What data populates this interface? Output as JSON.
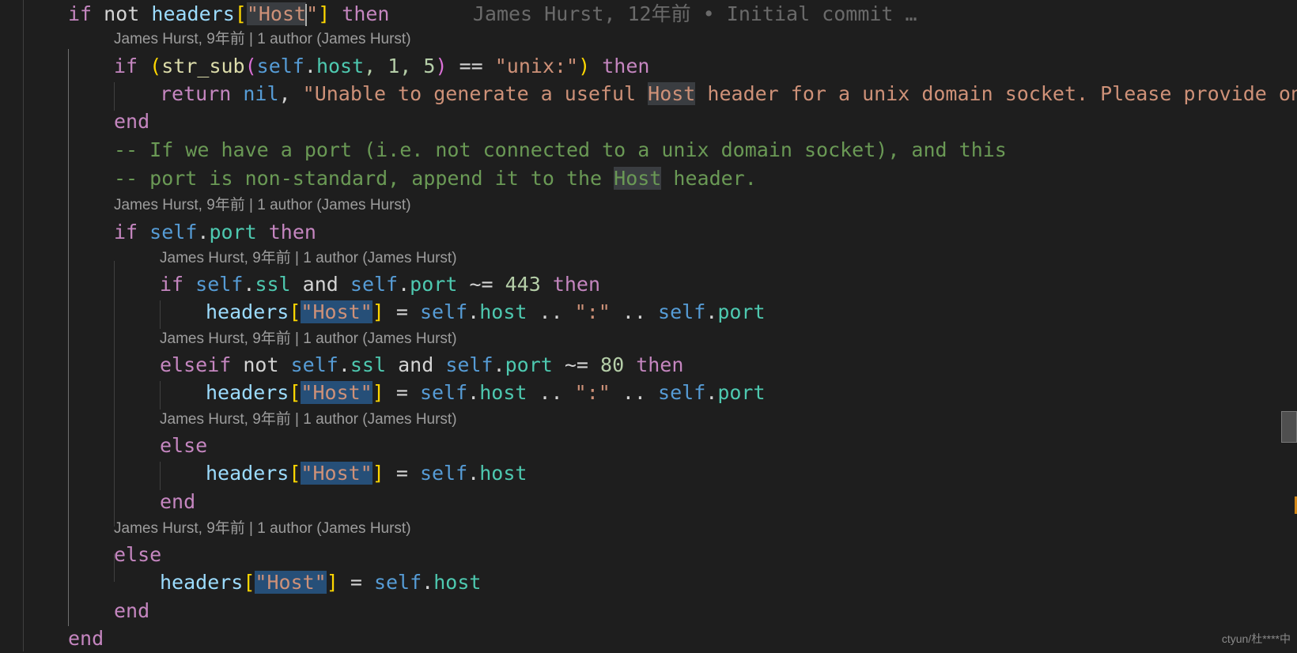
{
  "editor": {
    "lines": [
      {
        "parts": [
          "if",
          "not",
          "headers",
          "[",
          "\"Host",
          "\"",
          "]",
          "then"
        ],
        "blame": "James Hurst, 12年前 • Initial commit …"
      },
      {
        "lens": "James Hurst, 9年前 | 1 author (James Hurst)"
      },
      {
        "parts": [
          "if",
          "(",
          "str_sub",
          "(",
          "self",
          ".",
          "host",
          ", 1, 5",
          ")",
          " == ",
          "\"unix:\"",
          ")",
          "then"
        ]
      },
      {
        "parts": [
          "return",
          "nil",
          ", ",
          "\"Unable to generate a useful ",
          "Host",
          " header for a unix domain socket. Please provide one.\""
        ]
      },
      {
        "parts": [
          "end"
        ]
      },
      {
        "parts": [
          "-- If we have a port (i.e. not connected to a unix domain socket), and this"
        ]
      },
      {
        "parts": [
          "-- port is non-standard, append it to the ",
          "Host",
          " header."
        ]
      },
      {
        "lens": "James Hurst, 9年前 | 1 author (James Hurst)"
      },
      {
        "parts": [
          "if",
          "self",
          ".",
          "port",
          "then"
        ]
      },
      {
        "lens": "James Hurst, 9年前 | 1 author (James Hurst)"
      },
      {
        "parts": [
          "if",
          "self",
          ".",
          "ssl",
          "and",
          "self",
          ".",
          "port",
          " ~= ",
          "443",
          "then"
        ]
      },
      {
        "parts": [
          "headers",
          "[",
          "\"Host\"",
          "]",
          " = ",
          "self",
          ".",
          "host",
          " .. ",
          "\":\"",
          " .. ",
          "self",
          ".",
          "port"
        ]
      },
      {
        "lens": "James Hurst, 9年前 | 1 author (James Hurst)"
      },
      {
        "parts": [
          "elseif",
          "not",
          "self",
          ".",
          "ssl",
          "and",
          "self",
          ".",
          "port",
          " ~= ",
          "80",
          "then"
        ]
      },
      {
        "parts": [
          "headers",
          "[",
          "\"Host\"",
          "]",
          " = ",
          "self",
          ".",
          "host",
          " .. ",
          "\":\"",
          " .. ",
          "self",
          ".",
          "port"
        ]
      },
      {
        "lens": "James Hurst, 9年前 | 1 author (James Hurst)"
      },
      {
        "parts": [
          "else"
        ]
      },
      {
        "parts": [
          "headers",
          "[",
          "\"Host\"",
          "]",
          " = ",
          "self",
          ".",
          "host"
        ]
      },
      {
        "parts": [
          "end"
        ]
      },
      {
        "lens": "James Hurst, 9年前 | 1 author (James Hurst)"
      },
      {
        "parts": [
          "else"
        ]
      },
      {
        "parts": [
          "headers",
          "[",
          "\"Host\"",
          "]",
          " = ",
          "self",
          ".",
          "host"
        ]
      },
      {
        "parts": [
          "end"
        ]
      },
      {
        "parts": [
          "end"
        ]
      }
    ]
  },
  "watermark": "ctyun/杜****中",
  "colors": {
    "background": "#1e1e1e",
    "keyword_control": "#c586c0",
    "variable": "#9cdcfe",
    "self": "#569cd6",
    "property": "#4ec9b0",
    "function": "#dcdcaa",
    "number": "#b5cea8",
    "string": "#ce9178",
    "comment": "#6a9955",
    "bracket_gold": "#ffd700",
    "selection_highlight": "#264f78"
  }
}
